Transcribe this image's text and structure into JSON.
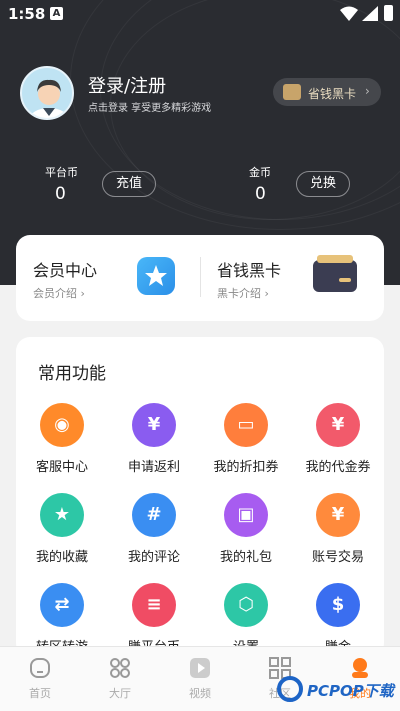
{
  "status_bar": {
    "time": "1:58",
    "notification_icon": "A"
  },
  "profile": {
    "title": "登录/注册",
    "subtitle": "点击登录 享受更多精彩游戏",
    "black_card_pill": "省钱黑卡"
  },
  "balances": {
    "platform_coin_label": "平台币",
    "platform_coin_value": "0",
    "recharge_button": "充值",
    "gold_label": "金币",
    "gold_value": "0",
    "exchange_button": "兑换"
  },
  "member_card": {
    "member_title": "会员中心",
    "member_sub": "会员介绍",
    "black_title": "省钱黑卡",
    "black_sub": "黑卡介绍"
  },
  "functions": {
    "title": "常用功能",
    "items": [
      {
        "label": "客服中心",
        "icon": "headset-icon",
        "color": "#ff8a2a"
      },
      {
        "label": "申请返利",
        "icon": "rebate-icon",
        "color": "#8a5cf0"
      },
      {
        "label": "我的折扣券",
        "icon": "discount-ticket-icon",
        "color": "#ff7e3c"
      },
      {
        "label": "我的代金券",
        "icon": "voucher-icon",
        "color": "#f25a6b"
      },
      {
        "label": "我的收藏",
        "icon": "star-icon",
        "color": "#2dc7a6"
      },
      {
        "label": "我的评论",
        "icon": "comment-hash-icon",
        "color": "#3a8ef2"
      },
      {
        "label": "我的礼包",
        "icon": "gift-icon",
        "color": "#a75cf0"
      },
      {
        "label": "账号交易",
        "icon": "money-bag-icon",
        "color": "#ff8a3c"
      },
      {
        "label": "转区转游",
        "icon": "transfer-icon",
        "color": "#3a8ef2"
      },
      {
        "label": "賺平台币",
        "icon": "coin-stack-icon",
        "color": "#f04c64"
      },
      {
        "label": "设置",
        "icon": "settings-hex-icon",
        "color": "#2dc7a6"
      },
      {
        "label": "賺金",
        "icon": "gold-coins-icon",
        "color": "#3a6ef0"
      }
    ]
  },
  "bottom_nav": [
    {
      "label": "首页",
      "icon": "home-icon"
    },
    {
      "label": "大厅",
      "icon": "grid-circles-icon"
    },
    {
      "label": "视频",
      "icon": "video-icon"
    },
    {
      "label": "社区",
      "icon": "grid-squares-icon"
    },
    {
      "label": "我的",
      "icon": "profile-icon"
    }
  ],
  "watermark": "PCPOP下载",
  "colors": {
    "header_bg": "#2a2c31",
    "accent_gold": "#e9dcc0",
    "active_orange": "#ff7a1a"
  }
}
